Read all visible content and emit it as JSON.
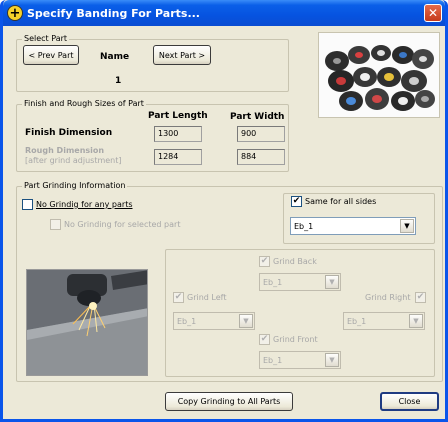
{
  "window": {
    "title": "Specify Banding For Parts...",
    "close_glyph": "✕",
    "app_icon_glyph": "+"
  },
  "select_part": {
    "group_title": "Select Part",
    "prev_label": "< Prev Part",
    "next_label": "Next Part >",
    "name_label": "Name",
    "part_number": "1"
  },
  "sizes": {
    "group_title": "Finish and Rough Sizes of Part",
    "col_length": "Part Length",
    "col_width": "Part Width",
    "finish_label": "Finish Dimension",
    "rough_label_1": "Rough Dimension",
    "rough_label_2": "[after grind adjustment]",
    "finish_length": "1300",
    "finish_width": "900",
    "rough_length": "1284",
    "rough_width": "884"
  },
  "grinding": {
    "group_title": "Part Grinding Information",
    "no_grind_any": "No Grindig for any parts",
    "no_grind_selected": "No Grinding for selected part",
    "same_all_sides": "Same for all sides",
    "same_all_value": "Eb_1",
    "back_label": "Grind Back",
    "back_value": "Eb_1",
    "left_label": "Grind Left",
    "left_value": "Eb_1",
    "right_label": "Grind Right",
    "right_value": "Eb_1",
    "front_label": "Grind Front",
    "front_value": "Eb_1"
  },
  "footer": {
    "copy_label": "Copy Grinding to All Parts",
    "close_label": "Close"
  },
  "icons": {
    "check": "✔",
    "dropdown": "▼"
  }
}
